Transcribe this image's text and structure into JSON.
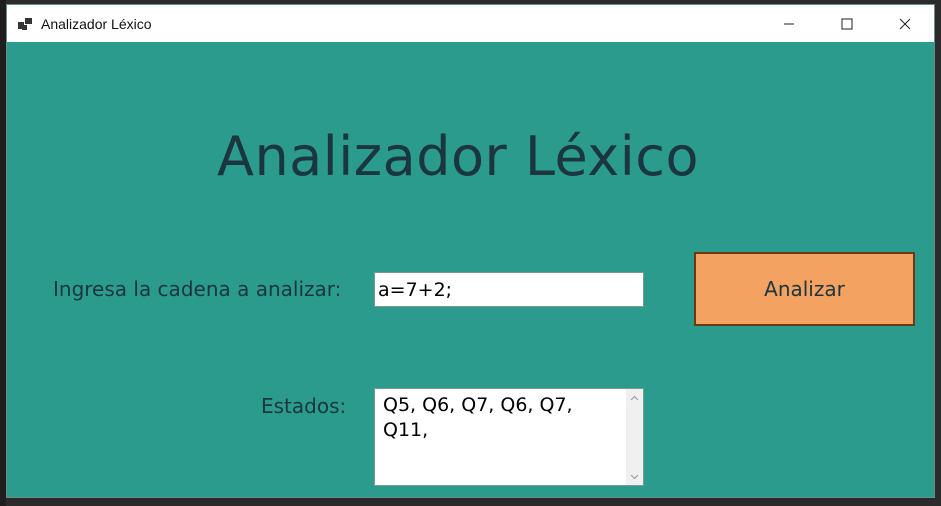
{
  "window": {
    "title": "Analizador Léxico",
    "controls": [
      "minimize",
      "maximize",
      "close"
    ]
  },
  "main": {
    "heading": "Analizador Léxico",
    "input_label": "Ingresa la cadena a analizar:",
    "input_value": "a=7+2;",
    "analyze_label": "Analizar",
    "states_label": "Estados:",
    "states_value": "Q5, Q6, Q7, Q6, Q7,\nQ11,"
  },
  "colors": {
    "window_bg": "#2a9b8c",
    "button_bg": "#f4a261",
    "button_border": "#6b3a12",
    "text": "#1c3640"
  },
  "icons": {
    "app": "app-window-icon",
    "minimize": "minimize-icon",
    "maximize": "maximize-icon",
    "close": "close-icon",
    "scroll_up": "chevron-up-icon",
    "scroll_down": "chevron-down-icon"
  }
}
